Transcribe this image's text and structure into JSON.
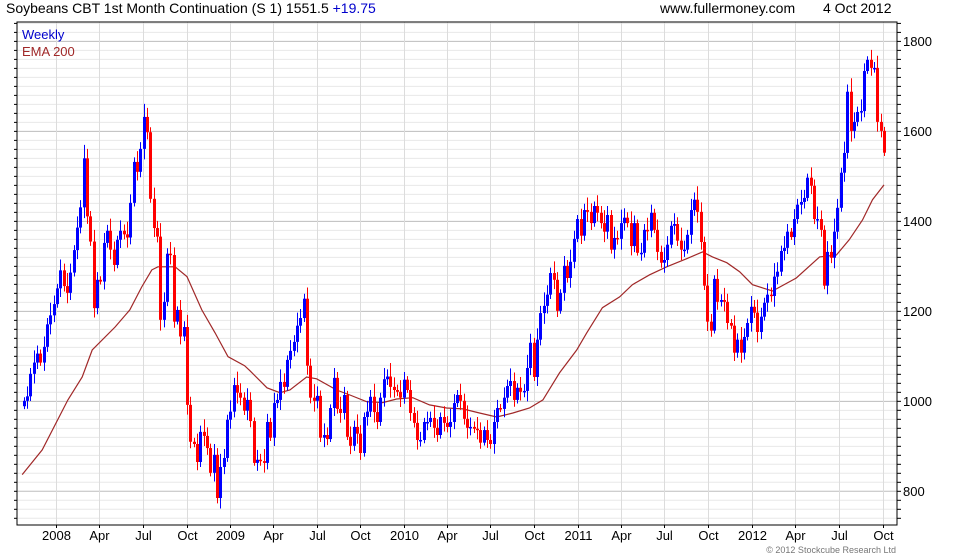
{
  "header": {
    "title": "Soybeans CBT 1st Month Continuation (S 1)",
    "last_price": "1551.5",
    "change": "+19.75",
    "website": "www.fullermoney.com",
    "date": "4 Oct 2012"
  },
  "legend": {
    "period": "Weekly",
    "indicator": "EMA 200"
  },
  "copyright": "© 2012 Stockcube Research Ltd",
  "colors": {
    "up": "#0000ff",
    "down": "#ff0000",
    "ema": "#a02828",
    "change": "#0000cc"
  },
  "chart_data": {
    "type": "candlestick",
    "frequency": "weekly",
    "last_bar_date": "2012-10-04",
    "ylim": [
      724,
      1842
    ],
    "y_ticks": [
      800,
      1000,
      1200,
      1400,
      1600,
      1800
    ],
    "x_ticks": [
      {
        "label": "2008",
        "date": "2008-01-01"
      },
      {
        "label": "Apr",
        "date": "2008-04-01"
      },
      {
        "label": "Jul",
        "date": "2008-07-01"
      },
      {
        "label": "Oct",
        "date": "2008-10-01"
      },
      {
        "label": "2009",
        "date": "2009-01-01"
      },
      {
        "label": "Apr",
        "date": "2009-04-01"
      },
      {
        "label": "Jul",
        "date": "2009-07-01"
      },
      {
        "label": "Oct",
        "date": "2009-10-01"
      },
      {
        "label": "2010",
        "date": "2010-01-01"
      },
      {
        "label": "Apr",
        "date": "2010-04-01"
      },
      {
        "label": "Jul",
        "date": "2010-07-01"
      },
      {
        "label": "Oct",
        "date": "2010-10-01"
      },
      {
        "label": "2011",
        "date": "2011-01-01"
      },
      {
        "label": "Apr",
        "date": "2011-04-01"
      },
      {
        "label": "Jul",
        "date": "2011-07-01"
      },
      {
        "label": "Oct",
        "date": "2011-10-01"
      },
      {
        "label": "2012",
        "date": "2012-01-01"
      },
      {
        "label": "Apr",
        "date": "2012-04-01"
      },
      {
        "label": "Jul",
        "date": "2012-07-01"
      },
      {
        "label": "Oct",
        "date": "2012-10-01"
      }
    ],
    "grid": true,
    "closes": [
      1000,
      1010,
      1060,
      1085,
      1105,
      1085,
      1120,
      1170,
      1190,
      1215,
      1250,
      1290,
      1255,
      1240,
      1285,
      1335,
      1385,
      1430,
      1539,
      1410,
      1354,
      1206,
      1269,
      1265,
      1351,
      1378,
      1336,
      1302,
      1358,
      1378,
      1370,
      1363,
      1440,
      1531,
      1509,
      1560,
      1631,
      1597,
      1449,
      1384,
      1365,
      1180,
      1220,
      1327,
      1324,
      1176,
      1202,
      1143,
      1164,
      991,
      909,
      904,
      864,
      931,
      922,
      895,
      840,
      880,
      784,
      853,
      873,
      958,
      976,
      1035,
      1018,
      1007,
      978,
      1002,
      955,
      862,
      869,
      866,
      862,
      953,
      918,
      995,
      1002,
      1042,
      1031,
      1091,
      1111,
      1131,
      1167,
      1184,
      1227,
      1078,
      1007,
      1000,
      1011,
      918,
      924,
      915,
      984,
      1051,
      982,
      973,
      1013,
      920,
      900,
      942,
      927,
      884,
      964,
      976,
      1009,
      975,
      953,
      1007,
      1048,
      1054,
      1031,
      1024,
      1020,
      1007,
      1047,
      1024,
      973,
      951,
      913,
      913,
      953,
      953,
      962,
      940,
      924,
      964,
      951,
      942,
      953,
      995,
      1013,
      1000,
      960,
      940,
      942,
      938,
      935,
      907,
      935,
      913,
      904,
      953,
      984,
      982,
      1007,
      1033,
      1044,
      1002,
      1029,
      1020,
      1022,
      1073,
      1129,
      1053,
      1136,
      1195,
      1211,
      1236,
      1284,
      1269,
      1200,
      1240,
      1300,
      1273,
      1309,
      1360,
      1404,
      1367,
      1424,
      1420,
      1395,
      1433,
      1418,
      1395,
      1376,
      1413,
      1336,
      1362,
      1360,
      1395,
      1407,
      1395,
      1344,
      1395,
      1329,
      1329,
      1380,
      1378,
      1418,
      1380,
      1331,
      1307,
      1313,
      1347,
      1389,
      1393,
      1356,
      1336,
      1336,
      1369,
      1424,
      1447,
      1420,
      1353,
      1256,
      1176,
      1156,
      1271,
      1220,
      1224,
      1220,
      1173,
      1167,
      1107,
      1136,
      1107,
      1142,
      1173,
      1209,
      1196,
      1153,
      1187,
      1218,
      1236,
      1233,
      1276,
      1287,
      1333,
      1340,
      1376,
      1364,
      1404,
      1436,
      1442,
      1451,
      1496,
      1478,
      1404,
      1404,
      1380,
      1256,
      1331,
      1318,
      1376,
      1429,
      1507,
      1551,
      1687,
      1600,
      1620,
      1642,
      1644,
      1733,
      1758,
      1740,
      1740,
      1620,
      1600,
      1551.5
    ],
    "ema": {
      "name": "EMA 200",
      "points": [
        [
          "2007-10-22",
          836
        ],
        [
          "2007-12-03",
          891
        ],
        [
          "2008-01-26",
          1002
        ],
        [
          "2008-02-25",
          1053
        ],
        [
          "2008-03-17",
          1113
        ],
        [
          "2008-05-04",
          1164
        ],
        [
          "2008-06-04",
          1202
        ],
        [
          "2008-06-29",
          1253
        ],
        [
          "2008-07-20",
          1291
        ],
        [
          "2008-08-02",
          1298
        ],
        [
          "2008-09-07",
          1298
        ],
        [
          "2008-10-02",
          1276
        ],
        [
          "2008-11-02",
          1202
        ],
        [
          "2008-11-30",
          1151
        ],
        [
          "2008-12-27",
          1098
        ],
        [
          "2009-01-31",
          1078
        ],
        [
          "2009-02-11",
          1067
        ],
        [
          "2009-03-19",
          1029
        ],
        [
          "2009-04-15",
          1018
        ],
        [
          "2009-05-06",
          1024
        ],
        [
          "2009-06-10",
          1053
        ],
        [
          "2009-07-01",
          1049
        ],
        [
          "2009-08-12",
          1024
        ],
        [
          "2009-09-09",
          1013
        ],
        [
          "2009-10-14",
          998
        ],
        [
          "2009-11-17",
          996
        ],
        [
          "2009-12-16",
          1004
        ],
        [
          "2010-01-19",
          1007
        ],
        [
          "2010-02-23",
          991
        ],
        [
          "2010-03-31",
          984
        ],
        [
          "2010-05-04",
          982
        ],
        [
          "2010-06-08",
          973
        ],
        [
          "2010-07-14",
          964
        ],
        [
          "2010-08-17",
          973
        ],
        [
          "2010-09-21",
          984
        ],
        [
          "2010-10-19",
          1002
        ],
        [
          "2010-11-23",
          1062
        ],
        [
          "2010-12-29",
          1113
        ],
        [
          "2011-01-19",
          1151
        ],
        [
          "2011-02-21",
          1207
        ],
        [
          "2011-03-29",
          1231
        ],
        [
          "2011-04-25",
          1258
        ],
        [
          "2011-05-31",
          1280
        ],
        [
          "2011-07-06",
          1298
        ],
        [
          "2011-08-17",
          1316
        ],
        [
          "2011-09-19",
          1331
        ],
        [
          "2011-10-10",
          1320
        ],
        [
          "2011-11-09",
          1307
        ],
        [
          "2011-12-06",
          1287
        ],
        [
          "2012-01-02",
          1258
        ],
        [
          "2012-02-13",
          1244
        ],
        [
          "2012-04-03",
          1273
        ],
        [
          "2012-05-22",
          1320
        ],
        [
          "2012-06-26",
          1324
        ],
        [
          "2012-07-23",
          1358
        ],
        [
          "2012-08-20",
          1402
        ],
        [
          "2012-09-10",
          1447
        ],
        [
          "2012-10-04",
          1480
        ]
      ]
    }
  }
}
